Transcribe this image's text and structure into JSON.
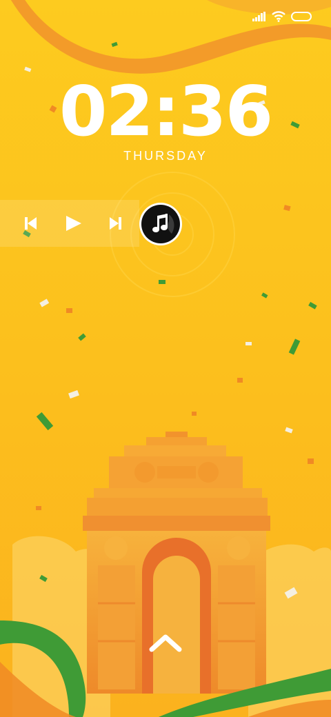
{
  "lockscreen": {
    "time": "02:36",
    "day": "THURSDAY"
  },
  "status_bar": {
    "icons": [
      "signal-icon",
      "wifi-icon",
      "battery-icon"
    ]
  },
  "media_player": {
    "controls": [
      "previous-track-icon",
      "play-icon",
      "next-track-icon"
    ],
    "album_art_icon": "music-note-icon"
  },
  "swipe_hint_icon": "chevron-up-icon",
  "wallpaper": {
    "theme": "India Gate with tricolor ribbons and confetti",
    "colors": {
      "background": "#FCC21E",
      "saffron": "#F08A24",
      "green": "#3F9B36",
      "gate_light": "#F6A83A",
      "gate_dark": "#E9762A"
    }
  }
}
